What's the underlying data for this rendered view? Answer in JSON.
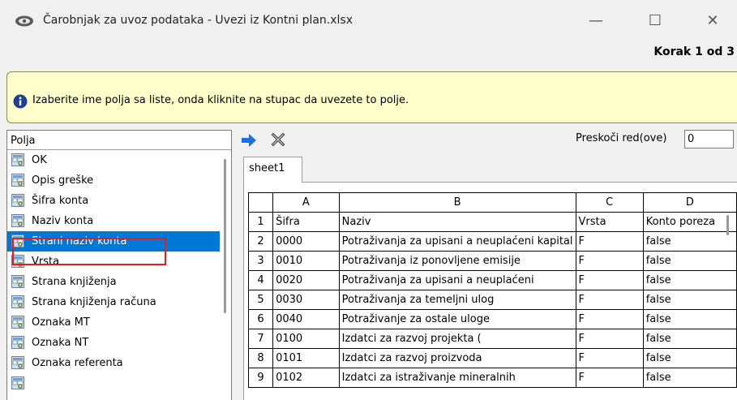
{
  "window": {
    "title": "Čarobnjak za uvoz podataka - Uvezi iz Kontni plan.xlsx",
    "step": "Korak 1 od 3",
    "controls": {
      "minimize": "—",
      "maximize": "☐",
      "close": "✕"
    }
  },
  "info": {
    "text": "Izaberite ime polja sa liste, onda kliknite na stupac da uvezete to polje."
  },
  "fields": {
    "header": "Polja",
    "items": [
      {
        "label": "OK"
      },
      {
        "label": "Opis greške"
      },
      {
        "label": "Šifra konta"
      },
      {
        "label": "Naziv konta"
      },
      {
        "label": "Strani naziv konta",
        "selected": true
      },
      {
        "label": "Vrsta"
      },
      {
        "label": "Strana knjiženja"
      },
      {
        "label": "Strana knjiženja računa"
      },
      {
        "label": "Oznaka MT"
      },
      {
        "label": "Oznaka NT"
      },
      {
        "label": "Oznaka  referenta"
      },
      {
        "label": ""
      }
    ]
  },
  "toolbar": {
    "skip_label": "Preskoči red(ove)",
    "skip_value": "0"
  },
  "sheet": {
    "tab": "sheet1",
    "columns": [
      "",
      "A",
      "B",
      "C",
      "D"
    ],
    "rows": [
      [
        "1",
        "Šifra",
        "Naziv",
        "Vrsta",
        "Konto poreza"
      ],
      [
        "2",
        "0000",
        "Potraživanja za upisani a neuplaćeni kapital",
        "F",
        "false"
      ],
      [
        "3",
        "0010",
        "Potraživanja iz ponovljene emisije",
        "F",
        "false"
      ],
      [
        "4",
        "0020",
        "Potraživanja za upisani a neuplaćeni",
        "F",
        "false"
      ],
      [
        "5",
        "0030",
        "Potraživanja za temeljni ulog",
        "F",
        "false"
      ],
      [
        "6",
        "0040",
        "Potraživanje za ostale uloge",
        "F",
        "false"
      ],
      [
        "7",
        "0100",
        "Izdatci za razvoj projekta (",
        "F",
        "false"
      ],
      [
        "8",
        "0101",
        "Izdatci za razvoj proizvoda",
        "F",
        "false"
      ],
      [
        "9",
        "0102",
        "Izdatci za istraživanje mineralnih",
        "F",
        "false"
      ]
    ]
  },
  "colors": {
    "info_bg": "#ffffcc",
    "selection": "#0078d7",
    "highlight_frame": "#e02020",
    "arrow": "#1e6fe0"
  },
  "icons": [
    "app-icon",
    "info-icon",
    "field-icon",
    "arrow-right-icon",
    "clear-mapping-icon"
  ]
}
